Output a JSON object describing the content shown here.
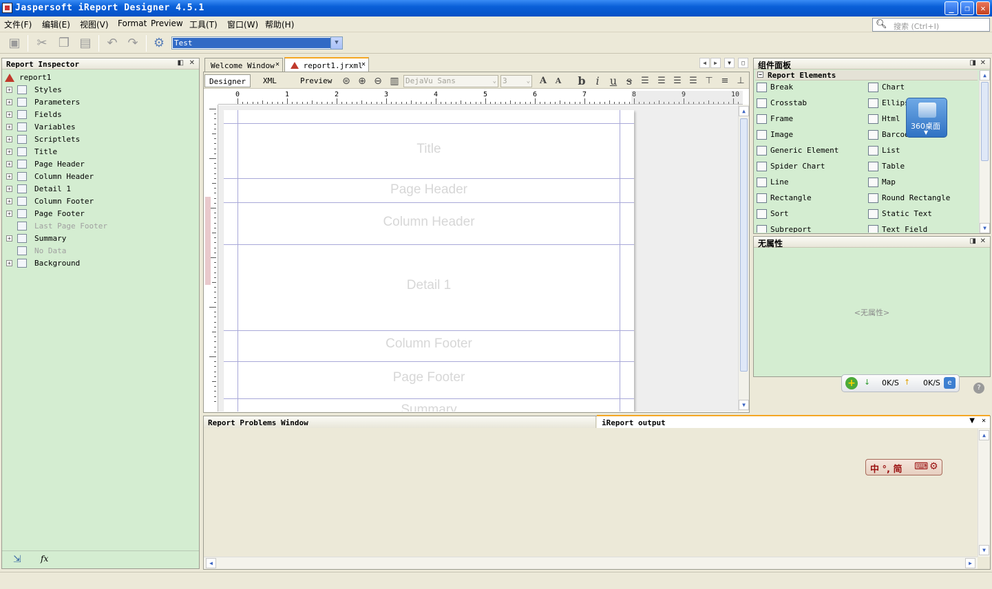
{
  "window": {
    "title": "Jaspersoft iReport Designer 4.5.1",
    "min": "_",
    "max": "❐",
    "close": "✕"
  },
  "menu": [
    "文件(F)",
    "编辑(E)",
    "视图(V)",
    "Format",
    "Preview",
    "工具(T)",
    "窗口(W)",
    "帮助(H)"
  ],
  "toolbar": {
    "datasource": "Test",
    "search_placeholder": "搜索 (Ctrl+I)"
  },
  "inspector": {
    "title": "Report Inspector",
    "root": "report1",
    "items": [
      {
        "label": "Styles",
        "dim": false
      },
      {
        "label": "Parameters",
        "dim": false
      },
      {
        "label": "Fields",
        "dim": false
      },
      {
        "label": "Variables",
        "dim": false
      },
      {
        "label": "Scriptlets",
        "dim": false
      },
      {
        "label": "Title",
        "dim": false
      },
      {
        "label": "Page Header",
        "dim": false
      },
      {
        "label": "Column Header",
        "dim": false
      },
      {
        "label": "Detail 1",
        "dim": false
      },
      {
        "label": "Column Footer",
        "dim": false
      },
      {
        "label": "Page Footer",
        "dim": false
      },
      {
        "label": "Last Page Footer",
        "dim": true
      },
      {
        "label": "Summary",
        "dim": false
      },
      {
        "label": "No Data",
        "dim": true
      },
      {
        "label": "Background",
        "dim": false
      }
    ]
  },
  "editor_tabs": [
    {
      "label": "Welcome Window",
      "active": false
    },
    {
      "label": "report1.jrxml",
      "active": true
    }
  ],
  "designer": {
    "subtabs": [
      "Designer",
      "XML",
      "Preview"
    ],
    "font_name": "DejaVu Sans",
    "font_size": "3",
    "ruler_labels": [
      "0",
      "1",
      "2",
      "3",
      "4",
      "5",
      "6",
      "7",
      "8",
      "9",
      "10"
    ],
    "bands": [
      "Title",
      "Page Header",
      "Column Header",
      "Detail 1",
      "Column Footer",
      "Page Footer",
      "Summary"
    ]
  },
  "palette": {
    "title": "组件面板",
    "section": "Report Elements",
    "left": [
      "Break",
      "Crosstab",
      "Frame",
      "Image",
      "Generic Element",
      "Spider Chart",
      "Line",
      "Rectangle",
      "Sort",
      "Subreport"
    ],
    "right": [
      "Chart",
      "Ellipse",
      "Html",
      "Barcode",
      "List",
      "Table",
      "Map",
      "Round Rectangle",
      "Static Text",
      "Text Field"
    ]
  },
  "properties": {
    "title": "无属性",
    "empty": "<无属性>"
  },
  "overlay_360": {
    "label": "360桌面"
  },
  "netspeed": {
    "down": "0K/S",
    "up": "0K/S"
  },
  "ime": {
    "text": "中 °, 简"
  },
  "problems": {
    "title": "Report Problems Window"
  },
  "output": {
    "title": "iReport output"
  }
}
